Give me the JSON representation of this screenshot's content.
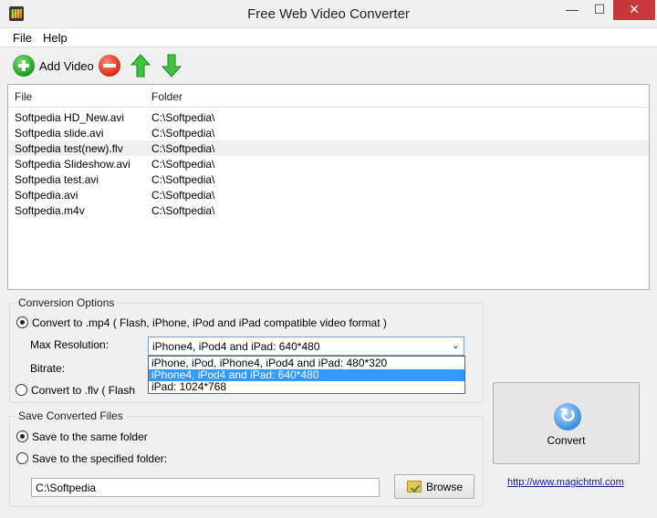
{
  "window": {
    "title": "Free Web Video Converter",
    "minimize_icon": "—",
    "maximize_icon": "☐",
    "close_icon": "✕"
  },
  "menu": [
    {
      "label": "File"
    },
    {
      "label": "Help"
    }
  ],
  "toolbar": {
    "add_label": "Add Video"
  },
  "file_list": {
    "columns": [
      "File",
      "Folder"
    ],
    "rows": [
      {
        "file": "Softpedia HD_New.avi",
        "folder": "C:\\Softpedia\\"
      },
      {
        "file": "Softpedia slide.avi",
        "folder": "C:\\Softpedia\\"
      },
      {
        "file": "Softpedia test(new).flv",
        "folder": "C:\\Softpedia\\"
      },
      {
        "file": "Softpedia Slideshow.avi",
        "folder": "C:\\Softpedia\\"
      },
      {
        "file": "Softpedia test.avi",
        "folder": "C:\\Softpedia\\"
      },
      {
        "file": "Softpedia.avi",
        "folder": "C:\\Softpedia\\"
      },
      {
        "file": "Softpedia.m4v",
        "folder": "C:\\Softpedia\\"
      }
    ],
    "selected_row": 2
  },
  "conversion": {
    "title": "Conversion Options",
    "mp4_label": "Convert to .mp4 ( Flash, iPhone, iPod and iPad compatible video format )",
    "mp4_selected": true,
    "max_res_label": "Max Resolution:",
    "max_res_value": "iPhone4, iPod4 and iPad: 640*480",
    "dropdown_arrow": "⌄",
    "options": [
      "iPhone, iPod, iPhone4, iPod4 and iPad: 480*320",
      "iPhone4, iPod4 and iPad: 640*480",
      "iPad: 1024*768"
    ],
    "bitrate_label": "Bitrate:",
    "flv_label": "Convert to .flv ( Flash",
    "flv_selected": false
  },
  "save": {
    "title": "Save Converted Files",
    "same_folder_label": "Save to the same folder",
    "same_selected": true,
    "specified_label": "Save to the specified folder:",
    "path_value": "C:\\Softpedia",
    "browse_label": "Browse"
  },
  "convert_label": "Convert",
  "link": "http://www.magichtml.com",
  "colors": {
    "selection": "#3399ff",
    "close_button": "#c7383b"
  }
}
